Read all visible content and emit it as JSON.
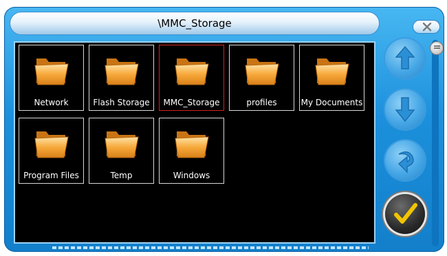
{
  "window": {
    "title": "\\MMC_Storage",
    "close_icon": "close-x-icon"
  },
  "folders": [
    {
      "label": "Network",
      "icon": "folder-icon",
      "selected": false
    },
    {
      "label": "Flash Storage",
      "icon": "folder-icon",
      "selected": false
    },
    {
      "label": "MMC_Storage",
      "icon": "folder-icon",
      "selected": true
    },
    {
      "label": "profiles",
      "icon": "folder-icon",
      "selected": false
    },
    {
      "label": "My Documents",
      "icon": "folder-icon",
      "selected": false
    },
    {
      "label": "Program Files",
      "icon": "folder-icon",
      "selected": false
    },
    {
      "label": "Temp",
      "icon": "folder-icon",
      "selected": false
    },
    {
      "label": "Windows",
      "icon": "folder-icon",
      "selected": false
    }
  ],
  "sidebar": {
    "buttons": [
      {
        "icon": "arrow-up-icon"
      },
      {
        "icon": "arrow-down-icon"
      },
      {
        "icon": "back-arrow-icon"
      },
      {
        "icon": "checkmark-icon"
      }
    ]
  },
  "colors": {
    "frame": "#1c90dc",
    "selection": "#d42020",
    "folder": "#f7a93a"
  }
}
